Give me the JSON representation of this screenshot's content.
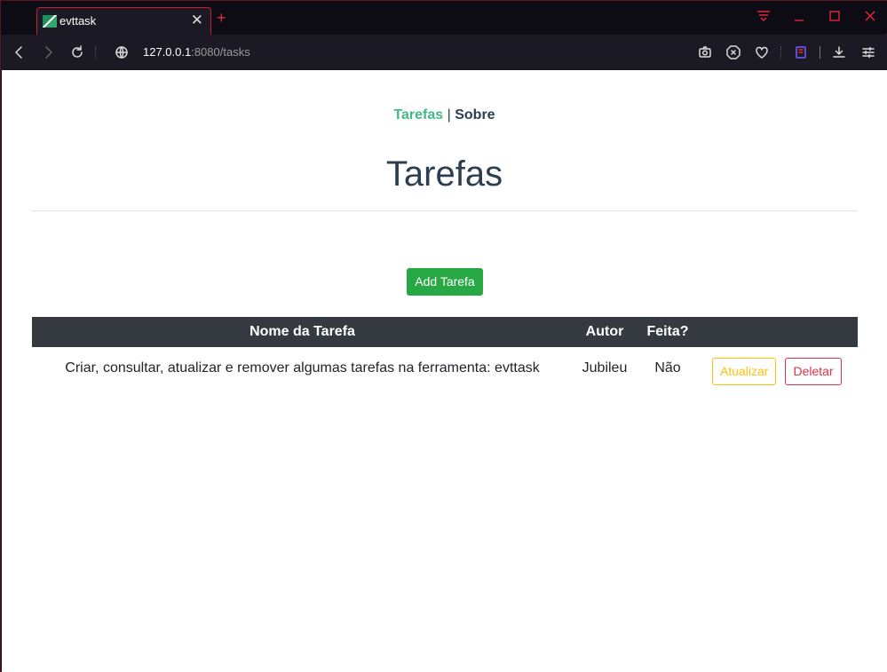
{
  "browser": {
    "tab_title": "evttask",
    "url_host": "127.0.0.1",
    "url_rest": ":8080/tasks",
    "accent_color": "#e2293a"
  },
  "nav": {
    "tasks_link": "Tarefas",
    "separator": "|",
    "about_link": "Sobre"
  },
  "main": {
    "title": "Tarefas",
    "add_button": "Add Tarefa"
  },
  "table": {
    "headers": [
      "Nome da Tarefa",
      "Autor",
      "Feita?",
      ""
    ],
    "rows": [
      {
        "name": "Criar, consultar, atualizar e remover algumas tarefas na ferramenta: evttask",
        "author": "Jubileu",
        "done": "Não",
        "update_button": "Atualizar",
        "delete_button": "Deletar"
      }
    ]
  },
  "colors": {
    "nav_active": "#42b983",
    "primary_text": "#2c3e50",
    "add_button": "#28a745",
    "table_header": "#343a40",
    "warning": "#ffc107",
    "danger": "#dc3545"
  }
}
